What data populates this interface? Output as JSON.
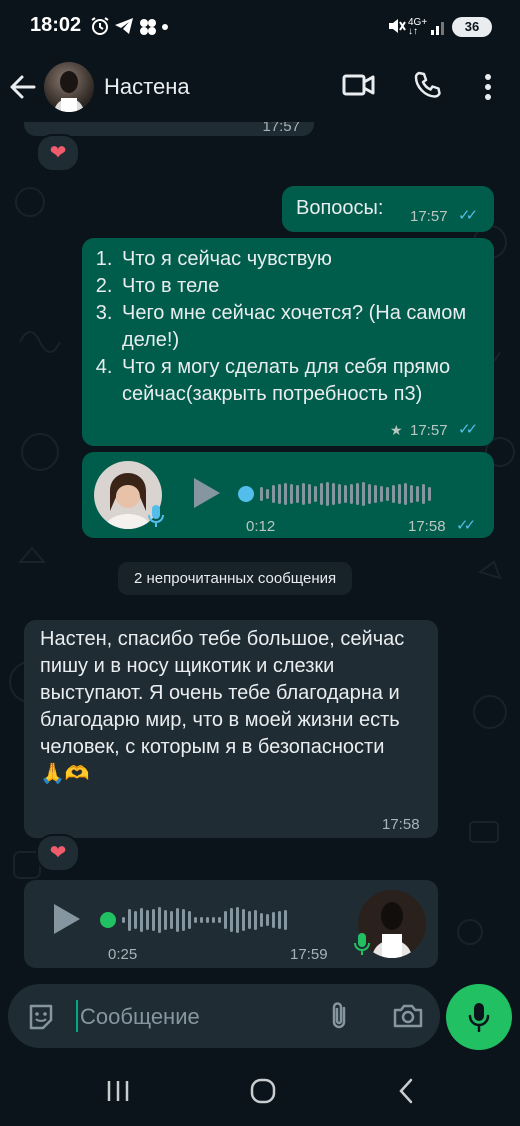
{
  "status_bar": {
    "time": "18:02",
    "battery": "36"
  },
  "header": {
    "contact_name": "Настена"
  },
  "messages": {
    "top_time": "17:57",
    "reaction1": "❤",
    "m1_text": "Вопоосы:",
    "m1_time": "17:57",
    "m2_items": [
      "Что я сейчас чувствую",
      "Что в теле",
      "Чего мне сейчас хочется? (На самом деле!)",
      "Что я могу сделать для себя прямо сейчас(закрыть потребность п3)"
    ],
    "m2_time": "17:57",
    "m3_duration": "0:12",
    "m3_time": "17:58",
    "unread_label": "2 непрочитанных сообщения",
    "m4_text": "Настен, спасибо тебе большое, сейчас пишу и в носу щикотик и слезки выступают. Я очень тебе благодарна и благодарю мир, что в моей жизни есть человек, с которым я в безопасности 🙏🫶",
    "m4_time": "17:58",
    "reaction2": "❤",
    "m5_duration": "0:25",
    "m5_time": "17:59"
  },
  "input": {
    "placeholder": "Сообщение"
  },
  "colors": {
    "outgoing": "#005c4b",
    "incoming": "#202c33",
    "accent": "#00a884",
    "mic": "#21c063",
    "read_ticks": "#53bdeb"
  }
}
